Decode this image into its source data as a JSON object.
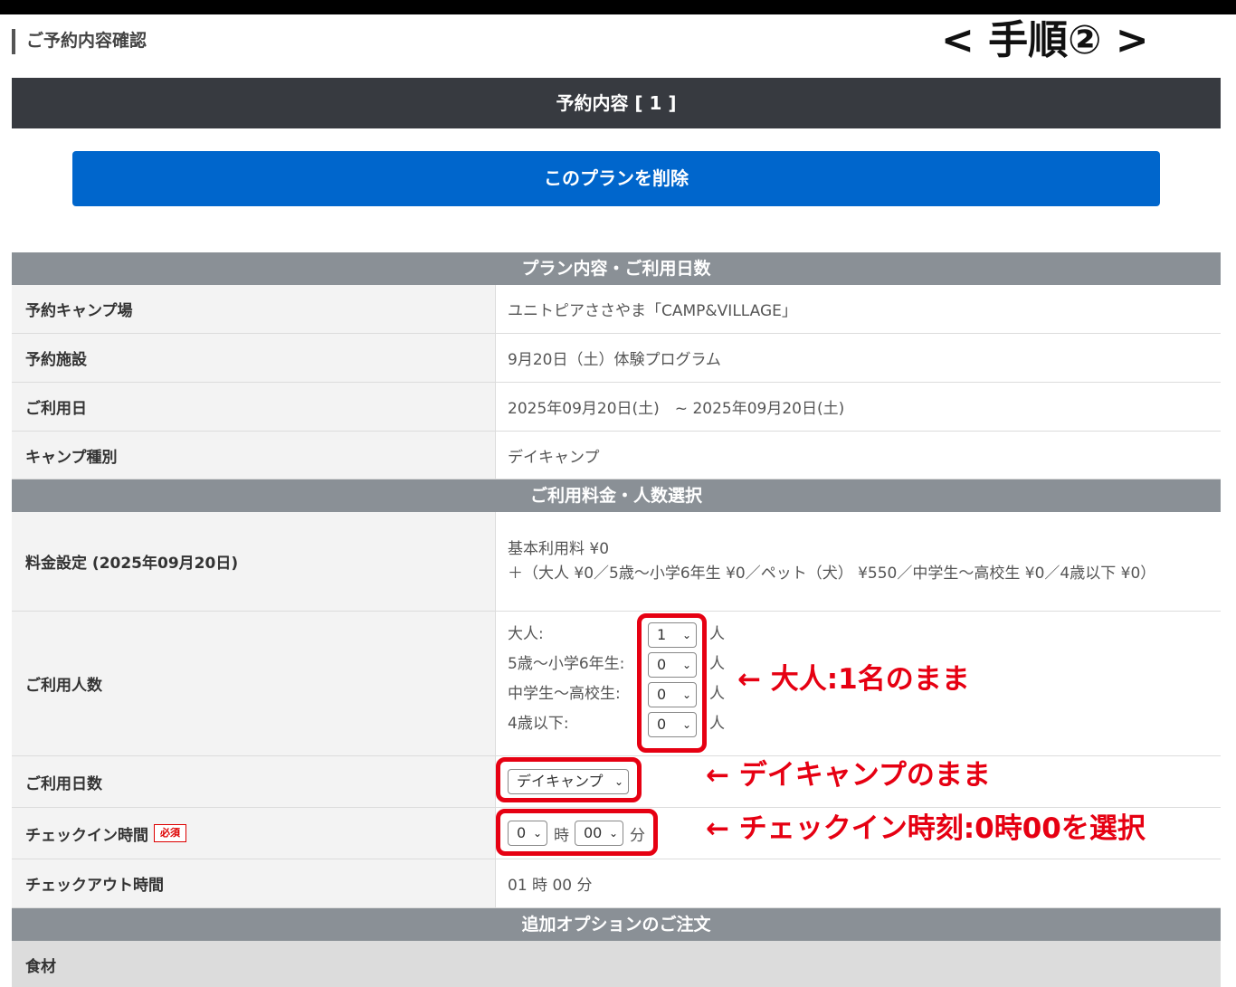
{
  "page": {
    "title": "ご予約内容確認",
    "step_title": "< 手順② >"
  },
  "reservation": {
    "header": "予約内容 [ 1 ]",
    "delete_label": "このプランを削除"
  },
  "sections": {
    "plan": "プラン内容・ご利用日数",
    "fees": "ご利用料金・人数選択",
    "options": "追加オプションのご注文"
  },
  "plan_rows": {
    "campground_label": "予約キャンプ場",
    "campground_value": "ユニトピアささやま「CAMP&VILLAGE」",
    "facility_label": "予約施設",
    "facility_value": "9月20日（土）体験プログラム",
    "date_label": "ご利用日",
    "date_value": "2025年09月20日(土)　~ 2025年09月20日(土)",
    "type_label": "キャンプ種別",
    "type_value": "デイキャンプ"
  },
  "fee_rows": {
    "price_label": "料金設定 (2025年09月20日)",
    "price_line1": "基本利用料 ¥0",
    "price_line2": "＋（大人 ¥0／5歳〜小学6年生 ¥0／ペット（犬） ¥550／中学生〜高校生 ¥0／4歳以下 ¥0）",
    "people_label": "ご利用人数",
    "people": [
      {
        "label": "大人:",
        "value": "1",
        "unit": "人"
      },
      {
        "label": "5歳〜小学6年生:",
        "value": "0",
        "unit": "人"
      },
      {
        "label": "中学生〜高校生:",
        "value": "0",
        "unit": "人"
      },
      {
        "label": "4歳以下:",
        "value": "0",
        "unit": "人"
      }
    ],
    "days_label": "ご利用日数",
    "days_value": "デイキャンプ",
    "checkin_label": "チェックイン時間",
    "checkin_required": "必須",
    "checkin_hour": "0",
    "checkin_hour_unit": "時",
    "checkin_min": "00",
    "checkin_min_unit": "分",
    "checkout_label": "チェックアウト時間",
    "checkout_value": "01 時 00 分"
  },
  "option_rows": {
    "food_label": "食材"
  },
  "annotations": {
    "adult": "← 大人:1名のまま",
    "days": "← デイキャンプのまま",
    "checkin": "← チェックイン時刻:0時00を選択"
  },
  "colors": {
    "primary_button": "#0066cc",
    "header_dark": "#373a40",
    "section_gray": "#8a9096",
    "annotation_red": "#e60012"
  }
}
